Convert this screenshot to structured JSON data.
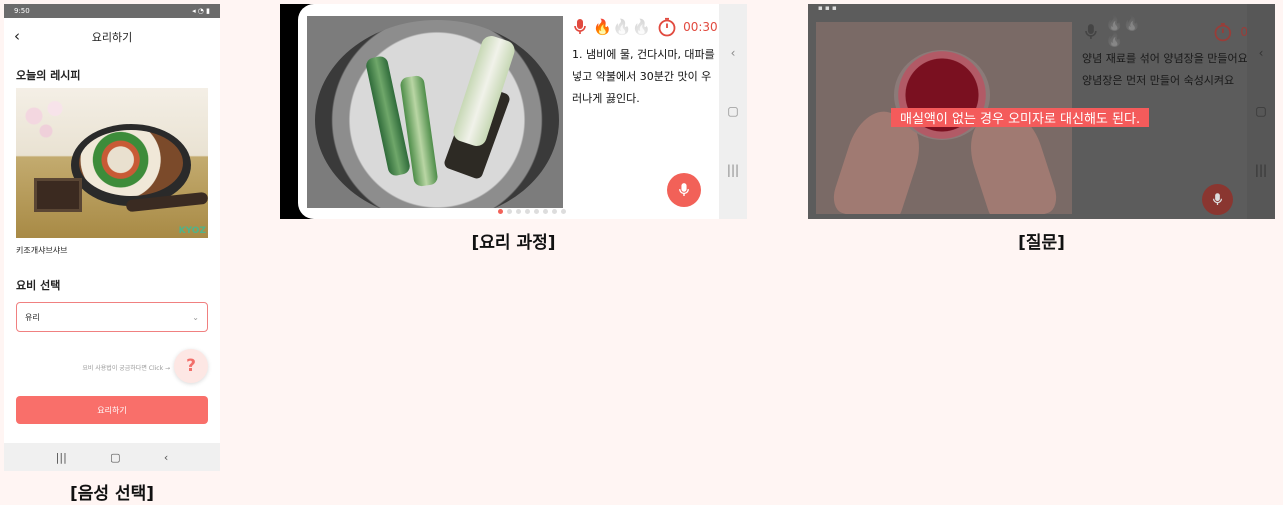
{
  "screen1": {
    "status_time": "9:50",
    "header_title": "요리하기",
    "section_recipe": "오늘의 레시피",
    "photo_watermark": "KYOZ",
    "dish_name": "키조개샤브샤브",
    "section_cookware": "요비 선택",
    "cookware_selected": "유리",
    "help_text": "요비 사용법이 궁금하다면 Click →",
    "help_button_label": "?",
    "start_button_label": "요리하기",
    "caption": "[음성 선택]"
  },
  "screen2": {
    "timer": "00:30",
    "step_text": "1. 냄비에 물, 건다시마, 대파를 넣고 약불에서 30분간 맛이 우러나게 끓인다.",
    "heat_level": "1 of 3 flames lit",
    "page_count": 8,
    "active_page": 0,
    "caption": "[요리 과정]"
  },
  "screen3": {
    "timer": "00:00",
    "step_text": "양념 재료를 섞어 양념장을 만들어요. 양념장은 먼저 만들어 숙성시켜요",
    "answer_banner": "매실액이 없는 경우 오미자로 대신해도 된다.",
    "caption": "[질문]"
  },
  "colors": {
    "accent": "#f96f6a",
    "timer": "#e14a3f",
    "background": "#fff5f3"
  }
}
